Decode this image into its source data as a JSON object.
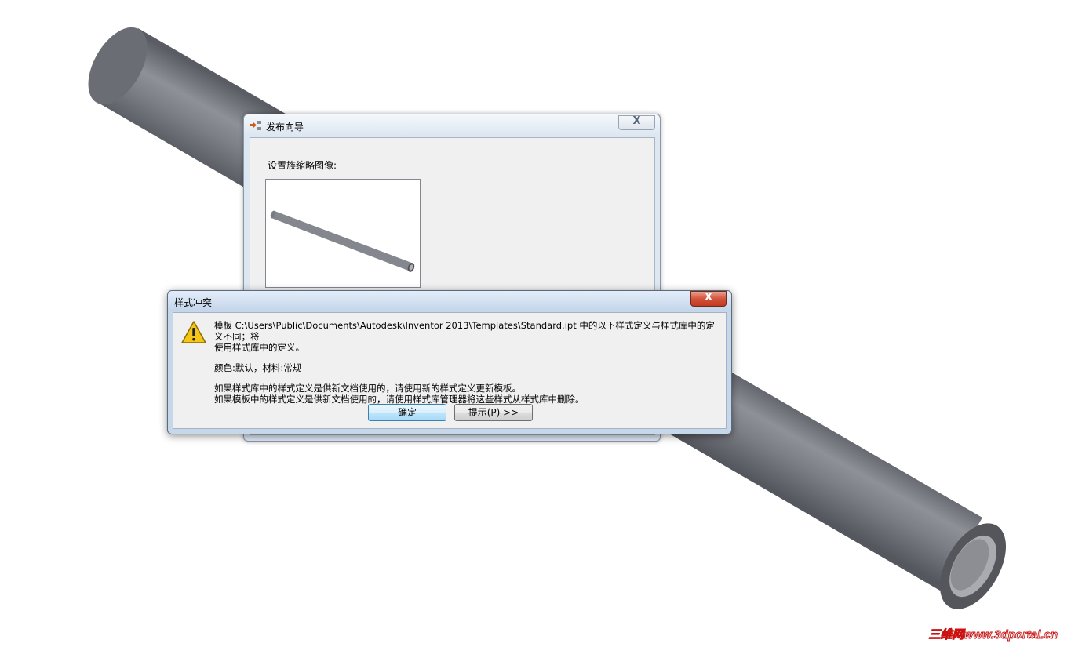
{
  "wizard": {
    "title": "发布向导",
    "thumbnail_label": "设置族缩略图像:",
    "close_label": "X"
  },
  "conflict_dialog": {
    "title": "样式冲突",
    "close_label": "X",
    "message_line1": "模板 C:\\Users\\Public\\Documents\\Autodesk\\Inventor 2013\\Templates\\Standard.ipt 中的以下样式定义与样式库中的定义不同；将",
    "message_line2": "使用样式库中的定义。",
    "styles_line": "颜色:默认，材料:常规",
    "advice_line1": "如果样式库中的样式定义是供新文档使用的，请使用新的样式定义更新模板。",
    "advice_line2": "如果模板中的样式定义是供新文档使用的，请使用样式库管理器将这些样式从样式库中删除。",
    "ok_label": "确定",
    "hint_label": "提示(P) >>"
  },
  "watermark": "三维网www.3dportal.cn"
}
